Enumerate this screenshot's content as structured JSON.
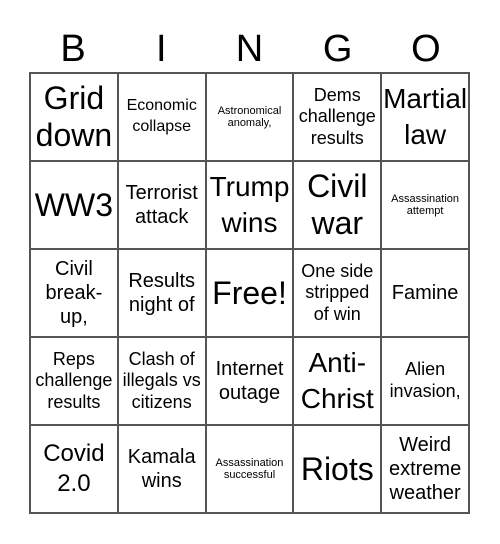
{
  "header": [
    "B",
    "I",
    "N",
    "G",
    "O"
  ],
  "cells": [
    "Grid down",
    "Economic collapse",
    "Astronomical anomaly,",
    "Dems challenge results",
    "Martial law",
    "WW3",
    "Terrorist attack",
    "Trump wins",
    "Civil war",
    "Assassination attempt",
    "Civil break-up,",
    "Results night of",
    "Free!",
    "One side stripped of win",
    "Famine",
    "Reps challenge results",
    "Clash of illegals vs citizens",
    "Internet outage",
    "Anti-Christ",
    "Alien invasion,",
    "Covid 2.0",
    "Kamala wins",
    "Assassination successful",
    "Riots",
    "Weird extreme weather"
  ]
}
